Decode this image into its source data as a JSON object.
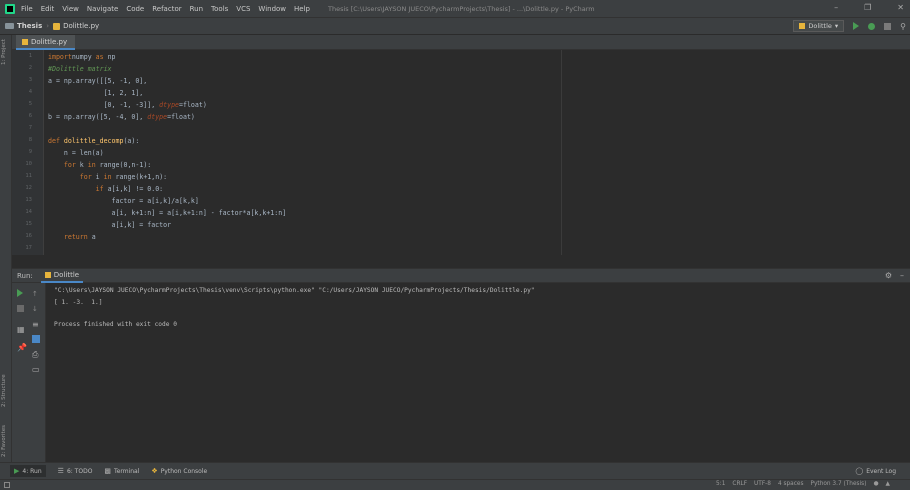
{
  "menubar": {
    "items": [
      "File",
      "Edit",
      "View",
      "Navigate",
      "Code",
      "Refactor",
      "Run",
      "Tools",
      "VCS",
      "Window",
      "Help"
    ],
    "window_title": "Thesis [C:\\Users\\JAYSON JUECO\\PycharmProjects\\Thesis] - ...\\Dolittle.py - PyCharm"
  },
  "navbar": {
    "project": "Thesis",
    "file": "Dolittle.py",
    "run_config": "Dolittle"
  },
  "editor": {
    "tab_label": "Dolittle.py",
    "line_numbers": [
      "1",
      "2",
      "3",
      "4",
      "5",
      "6",
      "7",
      "8",
      "9",
      "10",
      "11",
      "12",
      "13",
      "14",
      "15",
      "16",
      "17"
    ]
  },
  "run_window": {
    "label": "Run:",
    "tab_label": "Dolittle",
    "console_lines": [
      "\"C:\\Users\\JAYSON JUECO\\PycharmProjects\\Thesis\\venv\\Scripts\\python.exe\" \"C:/Users/JAYSON JUECO/PycharmProjects/Thesis/Dolittle.py\"",
      "[ 1. -3.  1.]",
      "",
      "Process finished with exit code 0"
    ]
  },
  "side_labels": {
    "project": "1: Project",
    "structure": "2: Structure",
    "favorites": "2: Favorites"
  },
  "bottom_bar": {
    "run": "4: Run",
    "todo": "6: TODO",
    "terminal": "Terminal",
    "python_console": "Python Console",
    "event_log": "Event Log"
  },
  "status_bar": {
    "position": "5:1",
    "line_sep": "CRLF",
    "encoding": "UTF-8",
    "indent": "4 spaces",
    "interpreter": "Python 3.7 (Thesis)"
  },
  "colors": {
    "background": "#2b2b2b",
    "panel": "#3c3f41",
    "keyword": "#cc7832",
    "comment": "#629755",
    "accent": "#4a88c7",
    "run_green": "#499c54"
  }
}
